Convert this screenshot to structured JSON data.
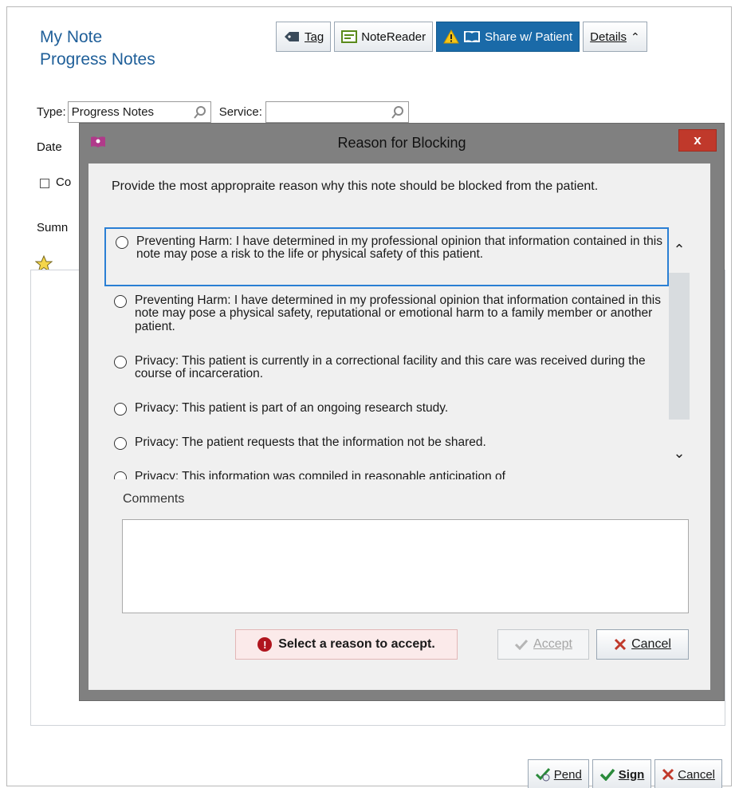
{
  "note": {
    "title": "My Note",
    "subtitle": "Progress Notes"
  },
  "toolbar": {
    "tag": "Tag",
    "notereader": "NoteReader",
    "share": "Share w/ Patient",
    "details": "Details"
  },
  "form": {
    "type_label": "Type:",
    "type_value": "Progress Notes",
    "service_label": "Service:",
    "service_value": "",
    "date_label": "Date",
    "cosign_label": "Co",
    "summary_label": "Sumn"
  },
  "modal": {
    "title": "Reason for Blocking",
    "close_label": "x",
    "prompt": "Provide the most appropraite reason why this note should be blocked from the patient.",
    "reasons": [
      "Preventing Harm: I have determined in my professional opinion that information contained in this note may pose a risk to the life or physical safety of this patient.",
      "Preventing Harm: I have determined in my professional opinion that information contained in this note may pose a physical safety, reputational or emotional harm to a family member or another patient.",
      "Privacy: This patient is currently in a correctional facility and this care was received during the course of incarceration.",
      "Privacy: This patient is part of an ongoing research study.",
      "Privacy: The patient requests that the information not be shared.",
      "Privacy: This information was compiled in reasonable anticipation of"
    ],
    "comments_label": "Comments",
    "comments_value": "",
    "validation_message": "Select a reason to accept.",
    "accept_label": "Accept",
    "cancel_label": "Cancel"
  },
  "footer": {
    "pend": "Pend",
    "sign": "Sign",
    "cancel": "Cancel"
  },
  "colors": {
    "link_blue": "#1f5f99",
    "share_blue": "#1a6aa8",
    "close_red": "#c0392b",
    "error_red": "#b0151e",
    "focus_blue": "#2a7fd4"
  }
}
